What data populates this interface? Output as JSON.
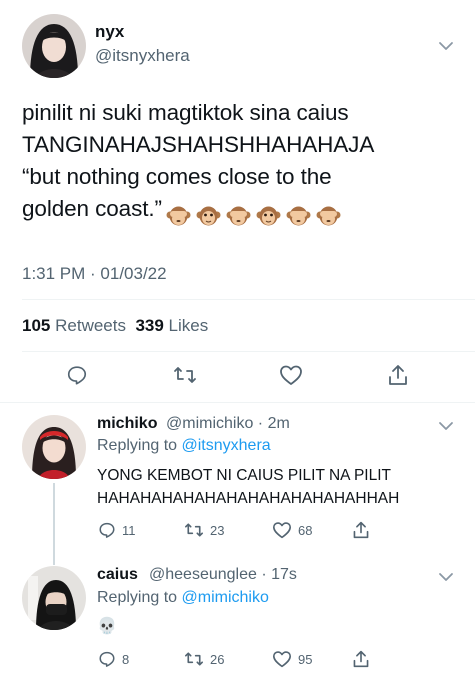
{
  "main_tweet": {
    "display_name": "nyx",
    "handle": "@itsnyxhera",
    "text_lines": [
      "pinilit ni suki magtiktok sina caius",
      "TANGINAHAJSHAHSHHAHAHAJA",
      "“but nothing comes close to the",
      "golden coast.”"
    ],
    "emojis": [
      "see-no-evil-monkey-emoji",
      "monkey-face-emoji",
      "see-no-evil-monkey-emoji",
      "monkey-face-emoji",
      "see-no-evil-monkey-emoji",
      "see-no-evil-monkey-emoji"
    ],
    "timestamp": "1:31 PM · 01/03/22",
    "retweets_count": "105",
    "retweets_label": "Retweets",
    "likes_count": "339",
    "likes_label": "Likes"
  },
  "replies": [
    {
      "display_name": "michiko",
      "meta": "@mimichiko · 2m",
      "replying_label": "Replying to",
      "replying_to": "@itsnyxhera",
      "text_lines": [
        "YONG KEMBOT NI CAIUS PILIT NA PILIT",
        "HAHAHAHAHAHAHAHAHAHAHAHAHHAH"
      ],
      "replies": "11",
      "retweets": "23",
      "likes": "68"
    },
    {
      "display_name": "caius",
      "meta": "@heeseunglee · 17s",
      "replying_label": "Replying to",
      "replying_to": "@mimichiko",
      "text_lines": [
        "💀"
      ],
      "replies": "8",
      "retweets": "26",
      "likes": "95"
    }
  ],
  "colors": {
    "text": "#0f1419",
    "secondary": "#536471",
    "accent": "#1d9bf0",
    "divider": "#eff3f4"
  }
}
